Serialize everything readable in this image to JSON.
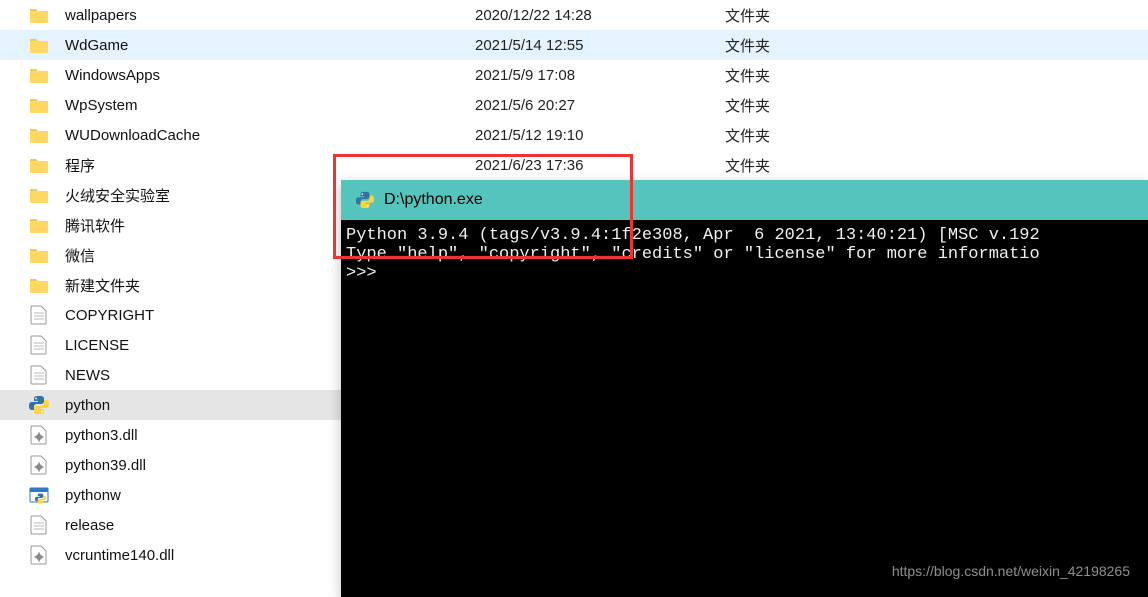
{
  "files": [
    {
      "iconType": "folder",
      "name": "wallpapers",
      "date": "2020/12/22 14:28",
      "type": "文件夹",
      "highlighted": false,
      "selected": false
    },
    {
      "iconType": "folder",
      "name": "WdGame",
      "date": "2021/5/14 12:55",
      "type": "文件夹",
      "highlighted": true,
      "selected": false
    },
    {
      "iconType": "folder",
      "name": "WindowsApps",
      "date": "2021/5/9 17:08",
      "type": "文件夹",
      "highlighted": false,
      "selected": false
    },
    {
      "iconType": "folder",
      "name": "WpSystem",
      "date": "2021/5/6 20:27",
      "type": "文件夹",
      "highlighted": false,
      "selected": false
    },
    {
      "iconType": "folder",
      "name": "WUDownloadCache",
      "date": "2021/5/12 19:10",
      "type": "文件夹",
      "highlighted": false,
      "selected": false
    },
    {
      "iconType": "folder",
      "name": "程序",
      "date": "2021/6/23 17:36",
      "type": "文件夹",
      "highlighted": false,
      "selected": false
    },
    {
      "iconType": "folder",
      "name": "火绒安全实验室",
      "date": "",
      "type": "",
      "highlighted": false,
      "selected": false
    },
    {
      "iconType": "folder",
      "name": "腾讯软件",
      "date": "",
      "type": "",
      "highlighted": false,
      "selected": false
    },
    {
      "iconType": "folder",
      "name": "微信",
      "date": "",
      "type": "",
      "highlighted": false,
      "selected": false
    },
    {
      "iconType": "folder",
      "name": "新建文件夹",
      "date": "",
      "type": "",
      "highlighted": false,
      "selected": false
    },
    {
      "iconType": "textfile",
      "name": "COPYRIGHT",
      "date": "",
      "type": "",
      "highlighted": false,
      "selected": false
    },
    {
      "iconType": "textfile",
      "name": "LICENSE",
      "date": "",
      "type": "",
      "highlighted": false,
      "selected": false
    },
    {
      "iconType": "textfile",
      "name": "NEWS",
      "date": "",
      "type": "",
      "highlighted": false,
      "selected": false
    },
    {
      "iconType": "python",
      "name": "python",
      "date": "",
      "type": "",
      "highlighted": false,
      "selected": true
    },
    {
      "iconType": "dll",
      "name": "python3.dll",
      "date": "",
      "type": "",
      "highlighted": false,
      "selected": false
    },
    {
      "iconType": "dll",
      "name": "python39.dll",
      "date": "",
      "type": "",
      "highlighted": false,
      "selected": false
    },
    {
      "iconType": "pythonw",
      "name": "pythonw",
      "date": "",
      "type": "",
      "highlighted": false,
      "selected": false
    },
    {
      "iconType": "textfile",
      "name": "release",
      "date": "",
      "type": "",
      "highlighted": false,
      "selected": false
    },
    {
      "iconType": "dll",
      "name": "vcruntime140.dll",
      "date": "",
      "type": "",
      "highlighted": false,
      "selected": false
    }
  ],
  "console": {
    "title": "D:\\python.exe",
    "line1": "Python 3.9.4 (tags/v3.9.4:1f2e308, Apr  6 2021, 13:40:21) [MSC v.192",
    "line2": "Type \"help\", \"copyright\", \"credits\" or \"license\" for more informatio",
    "prompt": ">>>"
  },
  "watermark": "https://blog.csdn.net/weixin_42198265"
}
